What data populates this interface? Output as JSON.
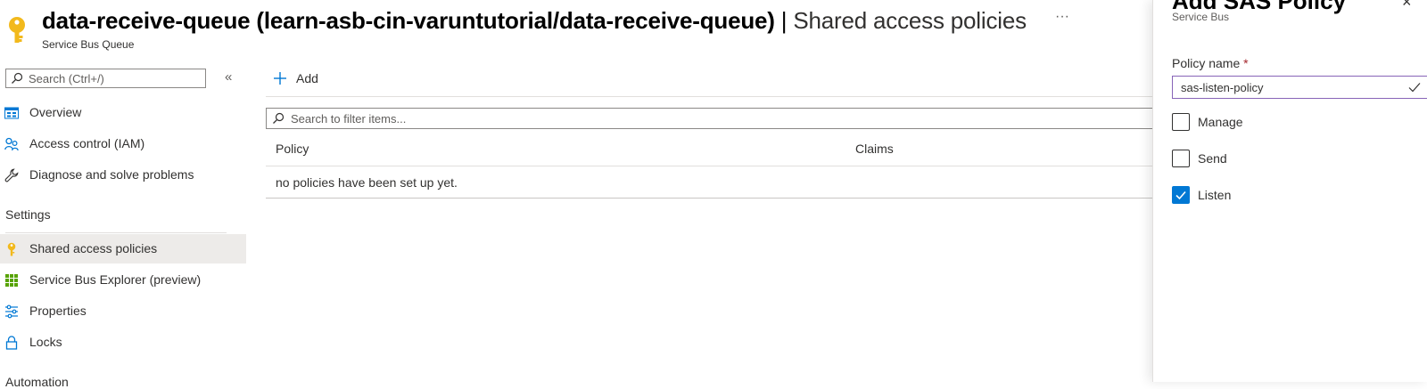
{
  "header": {
    "title_main": "data-receive-queue (learn-asb-cin-varuntutorial/data-receive-queue)",
    "title_separator": "|",
    "title_section": "Shared access policies",
    "more_label": "···",
    "resource_type": "Service Bus Queue",
    "icon": "key-icon"
  },
  "sidebar": {
    "search_placeholder": "Search (Ctrl+/)",
    "collapse_label": "«",
    "items": [
      {
        "label": "Overview",
        "icon": "overview-icon"
      },
      {
        "label": "Access control (IAM)",
        "icon": "people-icon"
      },
      {
        "label": "Diagnose and solve problems",
        "icon": "wrench-icon"
      }
    ],
    "settings_heading": "Settings",
    "settings_items": [
      {
        "label": "Shared access policies",
        "icon": "key-icon",
        "active": true
      },
      {
        "label": "Service Bus Explorer (preview)",
        "icon": "grid-icon"
      },
      {
        "label": "Properties",
        "icon": "sliders-icon"
      },
      {
        "label": "Locks",
        "icon": "lock-icon"
      }
    ],
    "automation_heading": "Automation"
  },
  "main": {
    "add_label": "Add",
    "filter_placeholder": "Search to filter items...",
    "table": {
      "columns": [
        "Policy",
        "Claims"
      ],
      "empty_message": "no policies have been set up yet."
    }
  },
  "panel": {
    "title": "Add SAS Policy",
    "close_label": "×",
    "subtitle": "Service Bus",
    "policy_name_label": "Policy name",
    "required_marker": "*",
    "policy_name_value": "sas-listen-policy",
    "claims": [
      {
        "label": "Manage",
        "checked": false
      },
      {
        "label": "Send",
        "checked": false
      },
      {
        "label": "Listen",
        "checked": true
      }
    ]
  },
  "colors": {
    "accent": "#0078d4",
    "key_yellow": "#f2b91c",
    "active_bg": "#edebe9",
    "input_focus": "#8764b8",
    "grid_green": "#57a300"
  }
}
